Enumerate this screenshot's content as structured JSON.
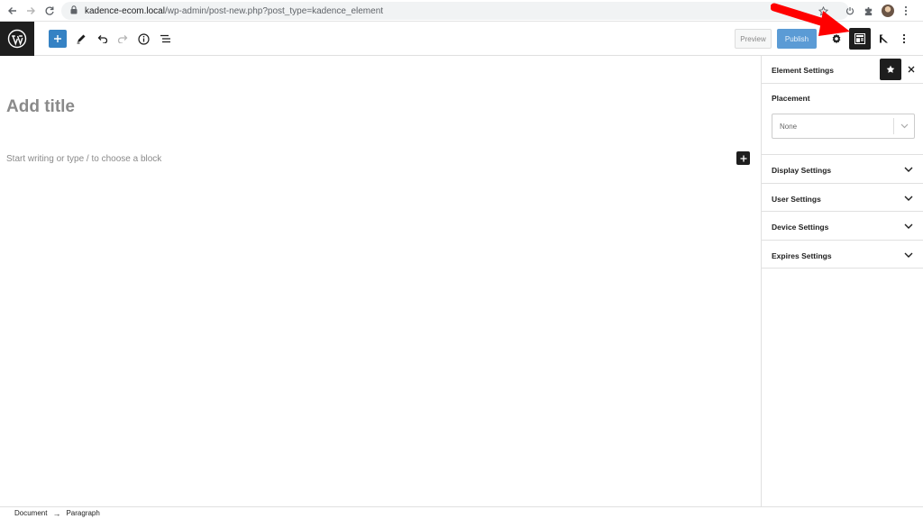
{
  "browser": {
    "url_host": "kadence-ecom.local",
    "url_path": "/wp-admin/post-new.php?post_type=kadence_element",
    "icons": [
      "back-arrow-icon",
      "forward-arrow-icon",
      "reload-icon",
      "lock-icon",
      "bookmark-star-icon",
      "power-icon",
      "puzzle-icon",
      "avatar",
      "kebab-menu-icon"
    ]
  },
  "toolbar": {
    "preview_label": "Preview",
    "publish_label": "Publish",
    "accent_color": "#3582c4"
  },
  "editor": {
    "title_placeholder": "Add title",
    "block_placeholder": "Start writing or type / to choose a block"
  },
  "sidebar": {
    "title": "Element Settings",
    "placement_label": "Placement",
    "placement_value": "None",
    "panels": [
      {
        "label": "Display Settings"
      },
      {
        "label": "User Settings"
      },
      {
        "label": "Device Settings"
      },
      {
        "label": "Expires Settings"
      }
    ]
  },
  "footer": {
    "crumbs": [
      "Document",
      "Paragraph"
    ]
  }
}
